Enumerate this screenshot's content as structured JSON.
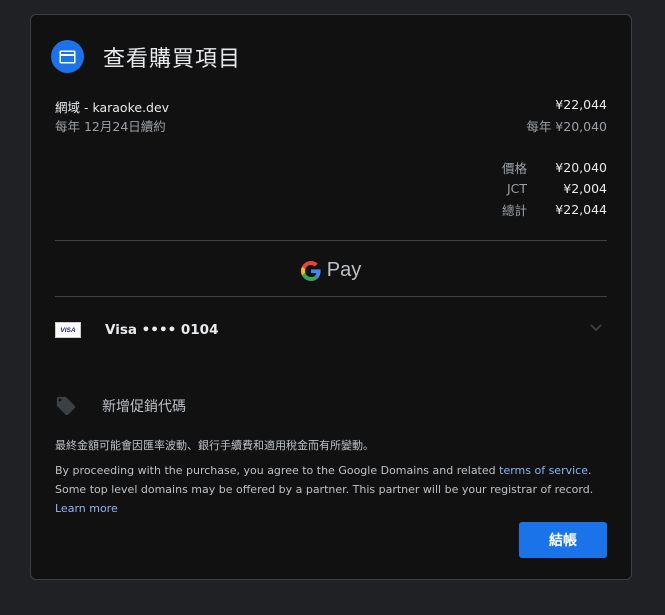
{
  "dialog": {
    "title": "查看購買項目",
    "icon": "credit-card-icon"
  },
  "item": {
    "name": "網域 - karaoke.dev",
    "price": "¥22,044",
    "renewal_text": "每年 12月24日續約",
    "renewal_price": "每年 ¥20,040"
  },
  "breakdown": [
    {
      "label": "價格",
      "value": "¥20,040"
    },
    {
      "label": "JCT",
      "value": "¥2,004"
    },
    {
      "label": "總計",
      "value": "¥22,044"
    }
  ],
  "gpay": {
    "text": "Pay"
  },
  "payment": {
    "brand": "VISA",
    "label": "Visa •••• 0104"
  },
  "promo": {
    "label": "新增促銷代碼",
    "icon": "tag-icon"
  },
  "notes": {
    "fx_notice": "最終金額可能會因匯率波動、銀行手續費和適用稅金而有所變動。",
    "terms_prefix": "By proceeding with the purchase, you agree to the Google Domains and related ",
    "terms_link": "terms of service",
    "terms_middle": ". Some top level domains may be offered by a partner. This partner will be your registrar of record. ",
    "learn_more": "Learn more"
  },
  "actions": {
    "checkout_label": "結帳"
  },
  "colors": {
    "accent": "#1a73e8",
    "link": "#8ab4f8",
    "dialog_bg": "#111111",
    "page_bg": "#202124"
  }
}
